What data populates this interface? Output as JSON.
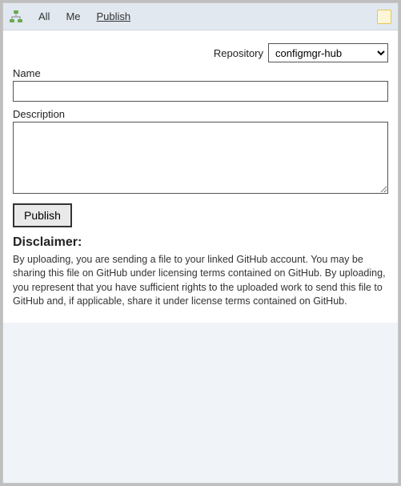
{
  "tabs": {
    "items": [
      {
        "label": "All",
        "active": false
      },
      {
        "label": "Me",
        "active": false
      },
      {
        "label": "Publish",
        "active": true
      }
    ]
  },
  "repository": {
    "label": "Repository",
    "selected": "configmgr-hub"
  },
  "form": {
    "name_label": "Name",
    "name_value": "",
    "description_label": "Description",
    "description_value": "",
    "publish_label": "Publish"
  },
  "disclaimer": {
    "heading": "Disclaimer:",
    "text": "By uploading, you are sending a file to your linked GitHub account. You may be sharing this file on GitHub under licensing terms contained on GitHub. By uploading, you represent that you have sufficient rights to the uploaded work to send this file to GitHub and, if applicable, share it under license terms contained on GitHub."
  }
}
